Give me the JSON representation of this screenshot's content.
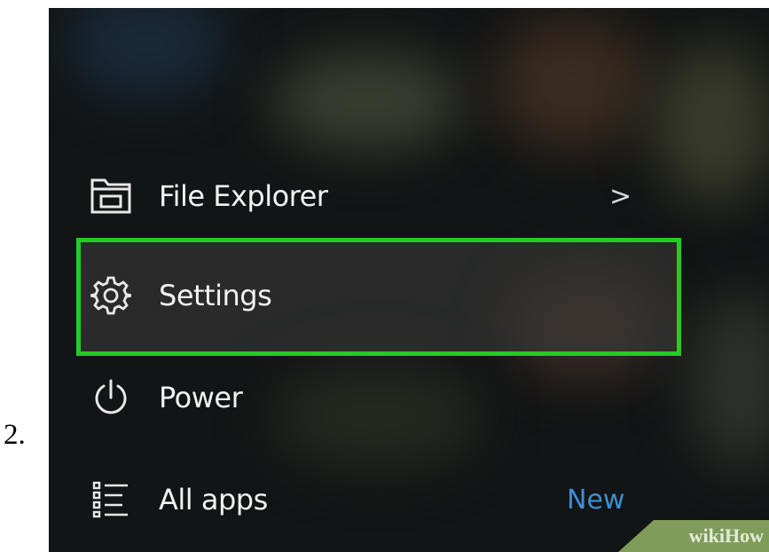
{
  "step": {
    "number": "2."
  },
  "start_menu": {
    "items": [
      {
        "label": "File Explorer",
        "icon": "folder-icon",
        "has_submenu": true,
        "submenu_glyph": ">"
      },
      {
        "label": "Settings",
        "icon": "gear-icon",
        "highlighted": true
      },
      {
        "label": "Power",
        "icon": "power-icon"
      },
      {
        "label": "All apps",
        "icon": "list-icon",
        "badge": "New"
      }
    ]
  },
  "watermark": {
    "text": "wikiHow"
  },
  "colors": {
    "highlight_border": "#22cc22",
    "badge_new": "#3f8fd8",
    "menu_background": "#121515",
    "watermark_background": "#7f9c5b"
  }
}
